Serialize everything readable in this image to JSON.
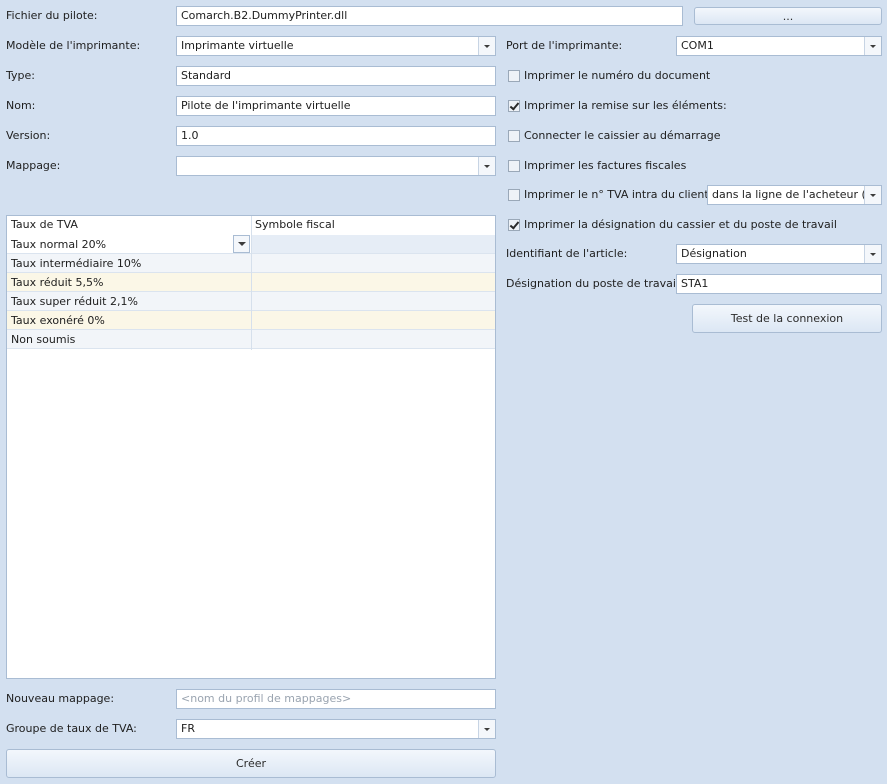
{
  "left": {
    "driver_file": {
      "label": "Fichier du pilote:",
      "value": "Comarch.B2.DummyPrinter.dll",
      "browse": "..."
    },
    "printer_model": {
      "label": "Modèle de l'imprimante:",
      "value": "Imprimante virtuelle"
    },
    "type": {
      "label": "Type:",
      "value": "Standard"
    },
    "name": {
      "label": "Nom:",
      "value": "Pilote de l'imprimante virtuelle"
    },
    "version": {
      "label": "Version:",
      "value": "1.0"
    },
    "mapping": {
      "label": "Mappage:",
      "value": ""
    },
    "grid": {
      "columns": [
        "Taux de TVA",
        "Symbole fiscal"
      ],
      "rows": [
        {
          "rate": "Taux normal 20%",
          "symbol": ""
        },
        {
          "rate": "Taux intermédiaire 10%",
          "symbol": ""
        },
        {
          "rate": "Taux réduit 5,5%",
          "symbol": ""
        },
        {
          "rate": "Taux super réduit 2,1%",
          "symbol": ""
        },
        {
          "rate": "Taux exonéré 0%",
          "symbol": ""
        },
        {
          "rate": "Non soumis",
          "symbol": ""
        }
      ]
    },
    "new_mapping": {
      "label": "Nouveau mappage:",
      "placeholder": "<nom du profil de mappages>"
    },
    "vat_group": {
      "label": "Groupe de taux de TVA:",
      "value": "FR"
    },
    "create_button": "Créer"
  },
  "right": {
    "printer_port": {
      "label": "Port de l'imprimante:",
      "value": "COM1"
    },
    "checkboxes": [
      {
        "label": "Imprimer le numéro du document",
        "checked": false
      },
      {
        "label": "Imprimer la remise sur les éléments:",
        "checked": true
      },
      {
        "label": "Connecter le caissier au démarrage",
        "checked": false
      },
      {
        "label": "Imprimer les factures fiscales",
        "checked": false
      },
      {
        "label": "Imprimer le n° TVA intra du client",
        "checked": false
      },
      {
        "label": "Imprimer la désignation du cassier et du poste de travail",
        "checked": true
      }
    ],
    "vat_position": {
      "value": "dans la ligne de l'acheteur (..."
    },
    "item_identifier": {
      "label": "Identifiant de l'article:",
      "value": "Désignation"
    },
    "workstation": {
      "label": "Désignation du poste de travail:",
      "value": "STA1"
    },
    "test_button": "Test de la connexion"
  },
  "colors": {
    "background": "#d3e0f0",
    "border": "#a9bcd3",
    "alt_row": "#fbf7e7"
  }
}
